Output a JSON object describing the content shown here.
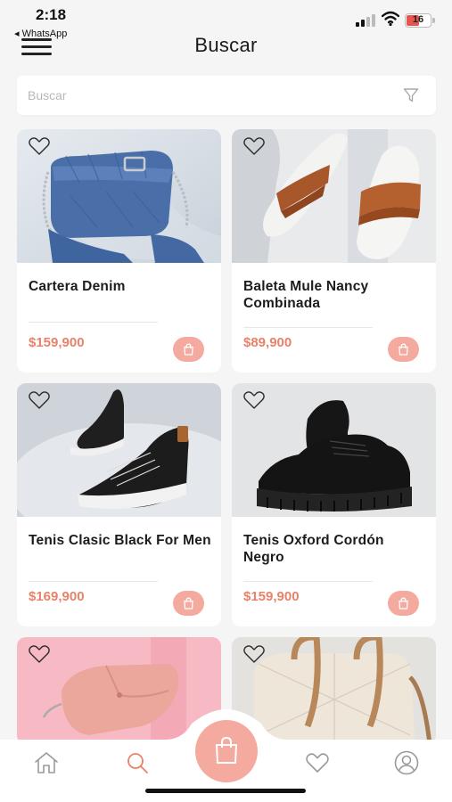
{
  "status_bar": {
    "time": "2:18",
    "back_app": "◂ WhatsApp",
    "battery_level": "16",
    "battery_color": "#e6564e"
  },
  "header": {
    "title": "Buscar",
    "menu_icon": "hamburger-menu-icon"
  },
  "search": {
    "placeholder": "Buscar",
    "value": "",
    "filter_icon": "filter-funnel-icon"
  },
  "products": [
    {
      "name": "Cartera Denim",
      "price": "$159,900",
      "image": "denim-handbag",
      "favorite": false
    },
    {
      "name": "Baleta Mule Nancy Combinada",
      "price": "$89,900",
      "image": "mule-flat-shoes",
      "favorite": false
    },
    {
      "name": "Tenis Clasic Black For Men",
      "price": "$169,900",
      "image": "black-sneakers",
      "favorite": false
    },
    {
      "name": "Tenis Oxford Cordón Negro",
      "price": "$159,900",
      "image": "oxford-black-shoes",
      "favorite": false
    },
    {
      "name": "",
      "price": "",
      "image": "pink-glasses-case",
      "favorite": false
    },
    {
      "name": "",
      "price": "",
      "image": "beige-tote-bag",
      "favorite": false
    }
  ],
  "bottom_nav": {
    "items": [
      "home-icon",
      "search-icon",
      "shopping-bag-icon",
      "heart-icon",
      "profile-icon"
    ],
    "active": "search-icon"
  },
  "colors": {
    "accent": "#f5aaa0",
    "price": "#e8826a",
    "background": "#f5f5f5"
  }
}
